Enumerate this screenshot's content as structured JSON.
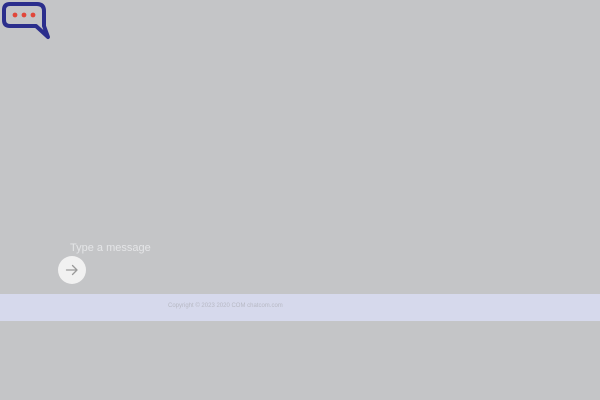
{
  "app": {
    "logo_icon": "chat-bubble-logo-icon",
    "brand_primary": "#2b2e8c",
    "brand_accent": "#e1473a",
    "brand_name": "",
    "chat_title": ""
  },
  "composer": {
    "placeholder": "Type a message",
    "value": "",
    "send_icon": "arrow-right-icon"
  },
  "footer": {
    "text": "Copyright © 2023 2020 COM chatcom.com",
    "background": "#d6d9ec"
  },
  "overlay": {
    "background": "#c4c5c7"
  }
}
